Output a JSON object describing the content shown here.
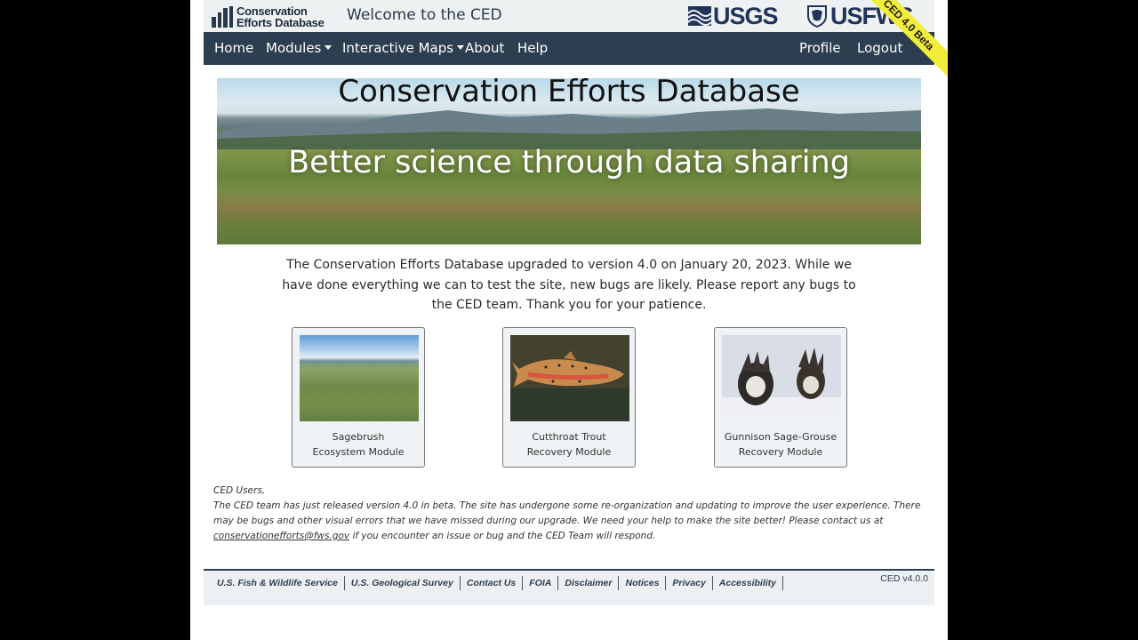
{
  "header": {
    "logo_line1": "Conservation",
    "logo_line2": "Efforts Database",
    "welcome": "Welcome to the CED",
    "usgs_logo": "USGS",
    "usfws_logo": "USFWS",
    "ribbon": "CED 4.0 Beta"
  },
  "nav": {
    "home": "Home",
    "modules": "Modules",
    "interactive_maps": "Interactive Maps",
    "about": "About",
    "help": "Help",
    "profile": "Profile",
    "logout": "Logout"
  },
  "hero": {
    "title": "Conservation Efforts Database",
    "subtitle": "Better science through data sharing"
  },
  "notice": "The Conservation Efforts Database upgraded to version 4.0 on January 20, 2023. While we have done everything we can to test the site, new bugs are likely. Please report any bugs to the CED team. Thank you for your patience.",
  "modules": [
    {
      "line1": "Sagebrush",
      "line2": "Ecosystem Module"
    },
    {
      "line1": "Cutthroat Trout",
      "line2": "Recovery Module"
    },
    {
      "line1": "Gunnison Sage-Grouse",
      "line2": "Recovery Module"
    }
  ],
  "users_note": {
    "greeting": "CED Users,",
    "body_before": "The CED team has just released version 4.0 in beta. The site has undergone some re-organization and updating to improve the user experience. There may be bugs and other visual errors that we have missed during our upgrade. We need your help to make the site better! Please contact us at ",
    "email": "conservationefforts@fws.gov",
    "body_after": " if you encounter an issue or bug and the CED Team will respond."
  },
  "footer": {
    "links": [
      "U.S. Fish & Wildlife Service",
      "U.S. Geological Survey",
      "Contact Us",
      "FOIA",
      "Disclaimer",
      "Notices",
      "Privacy",
      "Accessibility"
    ],
    "version": "CED v4.0.0"
  },
  "colors": {
    "navbar": "#2c3e50",
    "ribbon": "#f2ec3a",
    "background": "#000000"
  }
}
